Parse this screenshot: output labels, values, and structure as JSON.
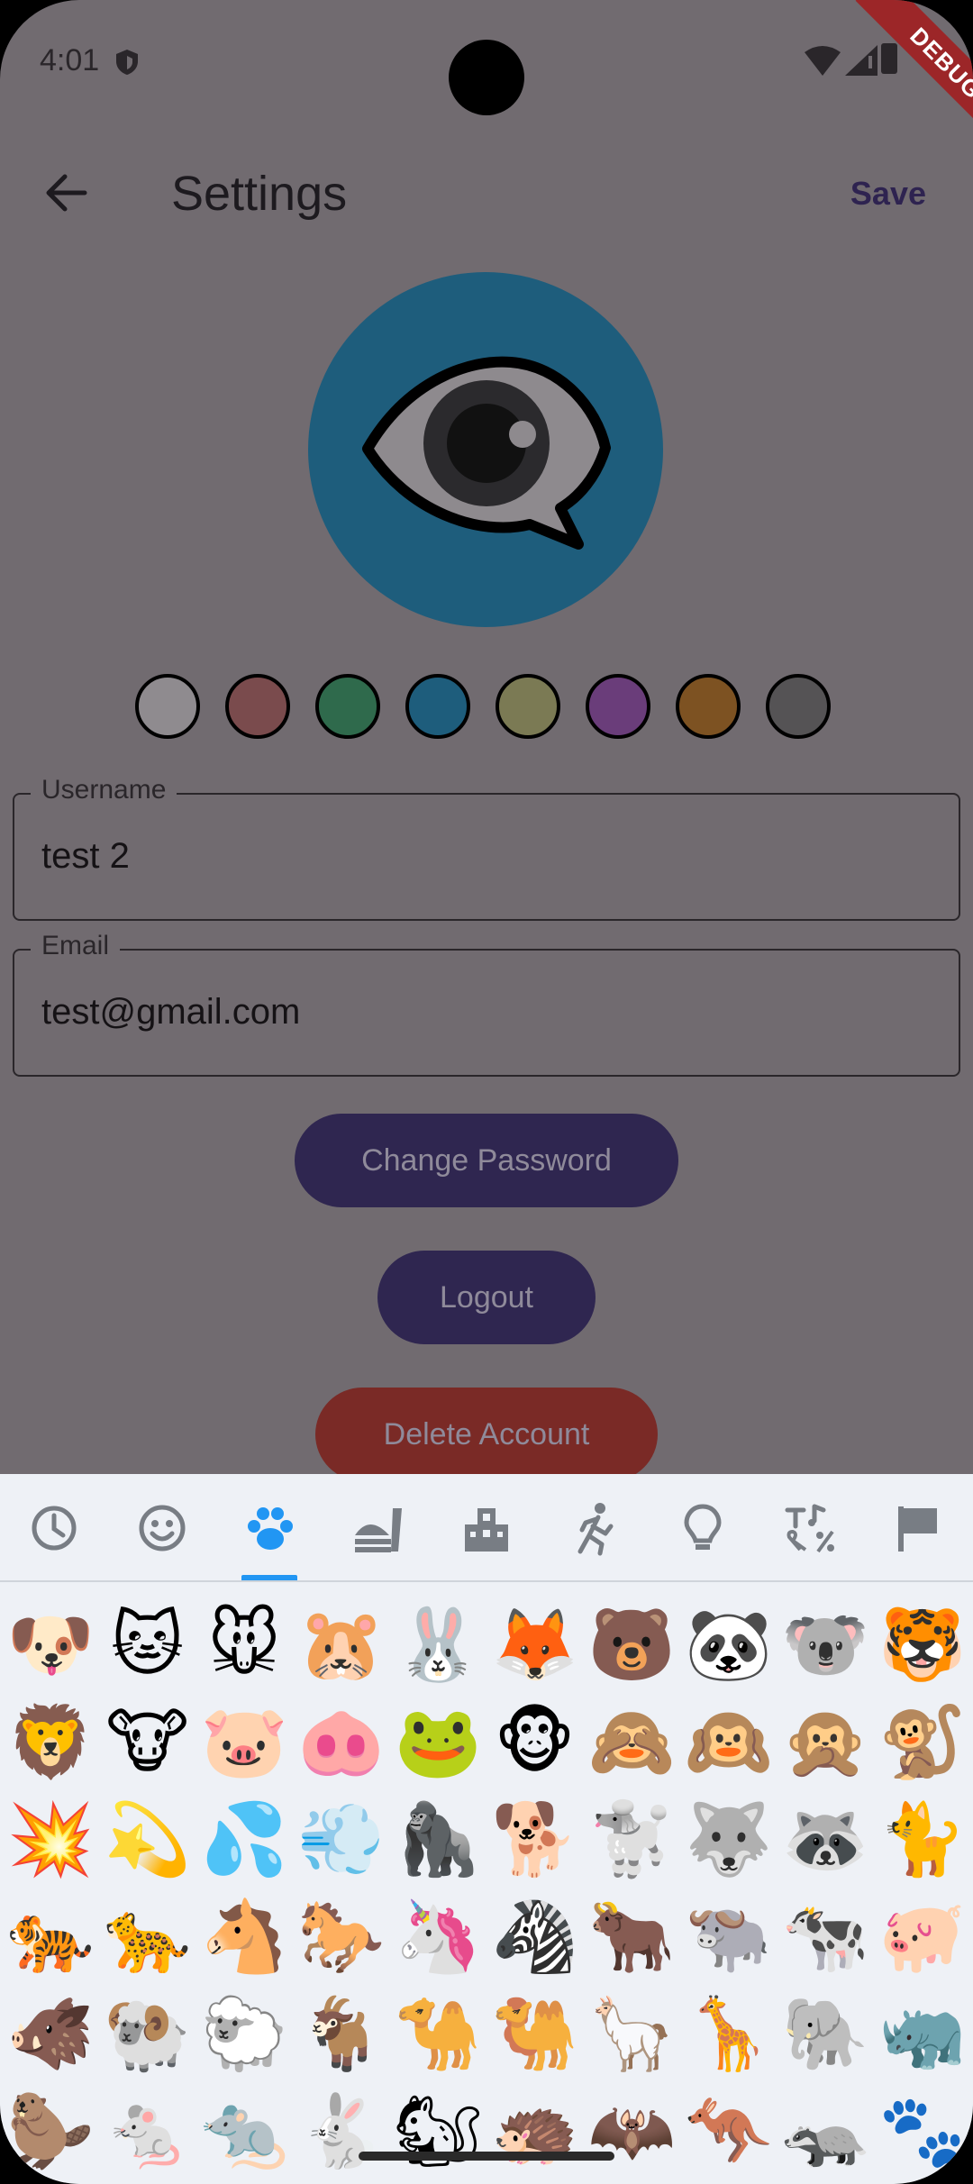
{
  "status_bar": {
    "time": "4:01",
    "debug_label": "DEBUG"
  },
  "app_bar": {
    "title": "Settings",
    "save_label": "Save"
  },
  "avatar": {
    "icon": "eye-speech-bubble-icon",
    "background": "#1e5d7c"
  },
  "color_options": [
    "#8f8b8f",
    "#7a4b4d",
    "#2f6a4c",
    "#1e5d7c",
    "#7b7a54",
    "#6a3d7a",
    "#7d5222",
    "#555355"
  ],
  "form": {
    "username": {
      "label": "Username",
      "value": "test 2"
    },
    "email": {
      "label": "Email",
      "value": "test@gmail.com"
    }
  },
  "buttons": {
    "change_password": "Change Password",
    "logout": "Logout",
    "delete_account": "Delete Account"
  },
  "emoji_keyboard": {
    "tabs": [
      "recent-clock-icon",
      "smiley-icon",
      "paw-icon",
      "food-icon",
      "building-icon",
      "activity-runner-icon",
      "lightbulb-icon",
      "symbols-icon",
      "flag-icon"
    ],
    "selected_tab": "paw-icon",
    "rows": [
      [
        "🐶",
        "🐱",
        "🐭",
        "🐹",
        "🐰",
        "🦊",
        "🐻",
        "🐼",
        "🐨",
        "🐯"
      ],
      [
        "🦁",
        "🐮",
        "🐷",
        "🐽",
        "🐸",
        "🐵",
        "🙈",
        "🙉",
        "🙊",
        "🐒"
      ],
      [
        "💥",
        "💫",
        "💦",
        "💨",
        "🦍",
        "🐕",
        "🐩",
        "🐺",
        "🦝",
        "🐈"
      ],
      [
        "🐅",
        "🐆",
        "🐴",
        "🐎",
        "🦄",
        "🦓",
        "🐂",
        "🐃",
        "🐄",
        "🐖"
      ],
      [
        "🐗",
        "🐏",
        "🐑",
        "🐐",
        "🐪",
        "🐫",
        "🦙",
        "🦒",
        "🐘",
        "🦏"
      ],
      [
        "🦫",
        "🐁",
        "🐀",
        "🐇",
        "🐿",
        "🦔",
        "🦇",
        "🦘",
        "🦡",
        "🐾"
      ]
    ]
  }
}
